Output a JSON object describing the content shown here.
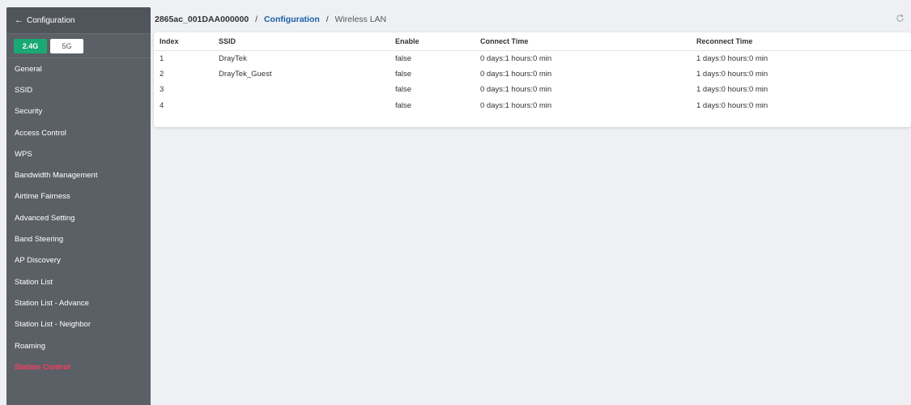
{
  "sidebar": {
    "back_label": "Configuration",
    "band_tabs": [
      {
        "label": "2.4G"
      },
      {
        "label": "5G"
      }
    ],
    "items": [
      {
        "label": "General"
      },
      {
        "label": "SSID"
      },
      {
        "label": "Security"
      },
      {
        "label": "Access Control"
      },
      {
        "label": "WPS"
      },
      {
        "label": "Bandwidth Management"
      },
      {
        "label": "Airtime Fairness"
      },
      {
        "label": "Advanced Setting"
      },
      {
        "label": "Band Steering"
      },
      {
        "label": "AP Discovery"
      },
      {
        "label": "Station List"
      },
      {
        "label": "Station List - Advance"
      },
      {
        "label": "Station List - Neighbor"
      },
      {
        "label": "Roaming"
      },
      {
        "label": "Station Control"
      }
    ],
    "active_item": "Station Control"
  },
  "breadcrumb": {
    "device": "2865ac_001DAA000000",
    "separator": "/",
    "section": "Configuration",
    "page": "Wireless LAN"
  },
  "table": {
    "headers": {
      "index": "Index",
      "ssid": "SSID",
      "enable": "Enable",
      "connect": "Connect Time",
      "reconnect": "Reconnect Time"
    },
    "rows": [
      {
        "index": "1",
        "ssid": "DrayTek",
        "enable": "false",
        "connect": "0 days:1 hours:0 min",
        "reconnect": "1 days:0 hours:0 min"
      },
      {
        "index": "2",
        "ssid": "DrayTek_Guest",
        "enable": "false",
        "connect": "0 days:1 hours:0 min",
        "reconnect": "1 days:0 hours:0 min"
      },
      {
        "index": "3",
        "ssid": "",
        "enable": "false",
        "connect": "0 days:1 hours:0 min",
        "reconnect": "1 days:0 hours:0 min"
      },
      {
        "index": "4",
        "ssid": "",
        "enable": "false",
        "connect": "0 days:1 hours:0 min",
        "reconnect": "1 days:0 hours:0 min"
      }
    ]
  },
  "icons": {
    "back": "arrow-left-icon",
    "refresh": "refresh-icon"
  },
  "colors": {
    "accent_green": "#1aa874",
    "active_red": "#ff3b5c",
    "sidebar_bg": "#5b6067",
    "link_blue": "#1a5fa8"
  }
}
